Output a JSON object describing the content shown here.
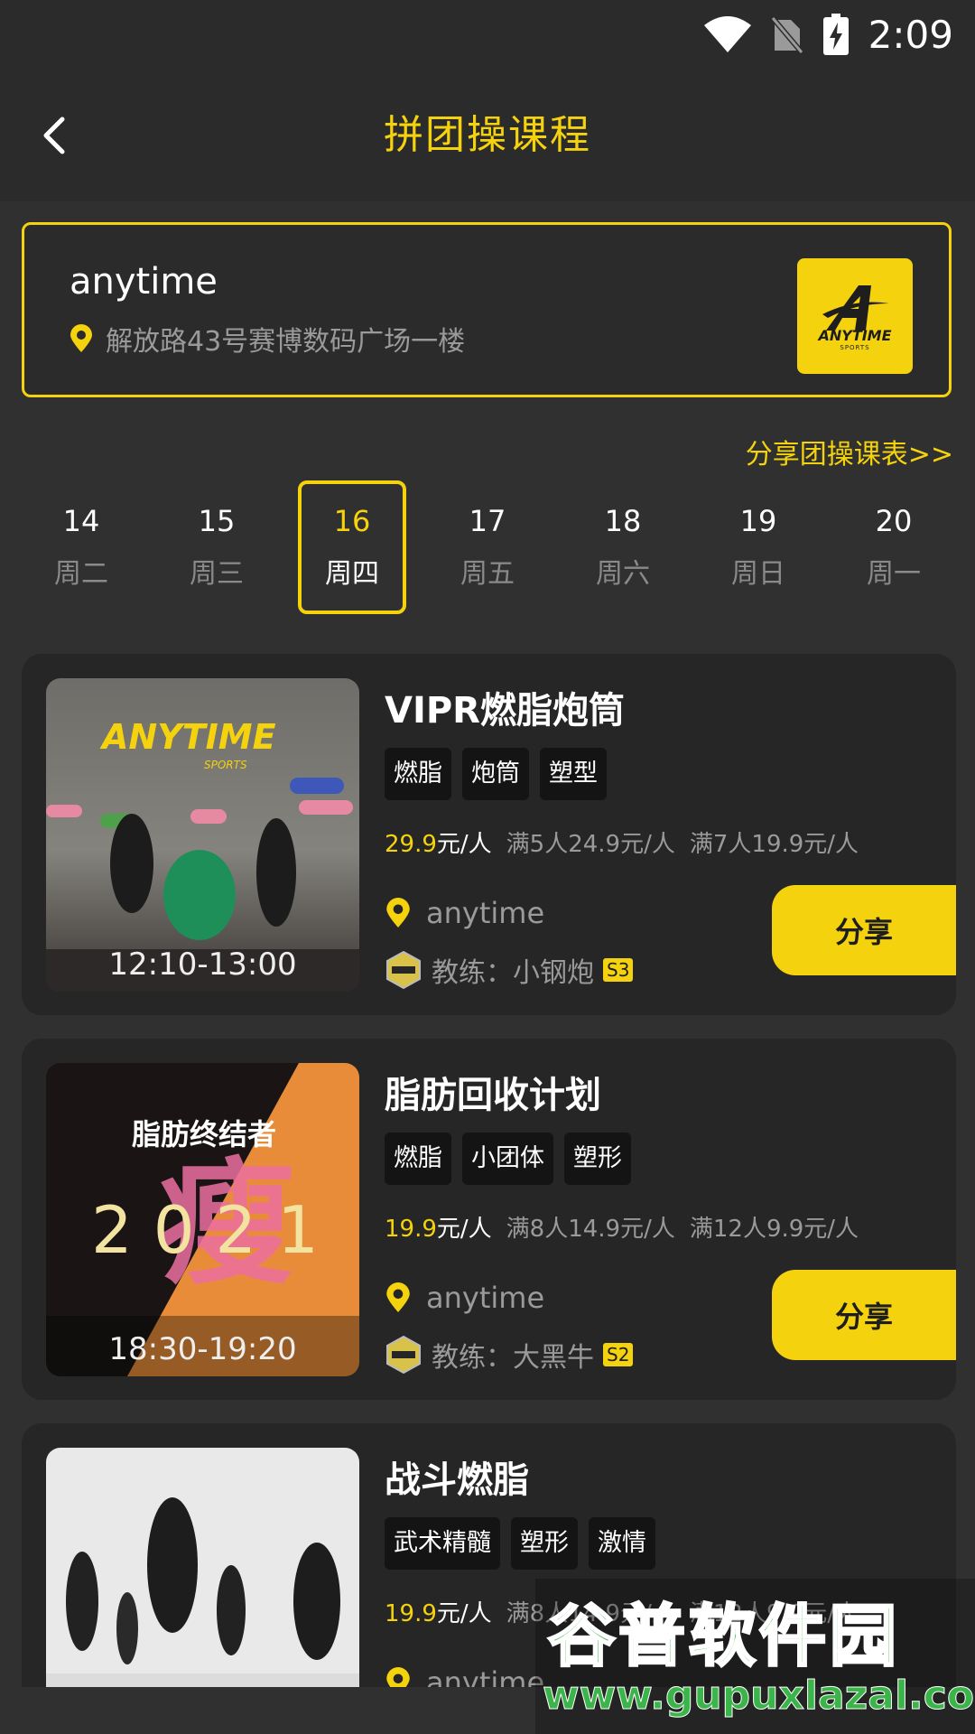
{
  "status_bar": {
    "time": "2:09"
  },
  "header": {
    "title": "拼团操课程"
  },
  "store": {
    "name": "anytime",
    "address": "解放路43号赛博数码广场一楼",
    "logo_text": "ANYTIME",
    "logo_sub": "SPORTS"
  },
  "share_schedule_label": "分享团操课表>>",
  "dates": [
    {
      "day": "14",
      "weekday": "周二",
      "active": false
    },
    {
      "day": "15",
      "weekday": "周三",
      "active": false
    },
    {
      "day": "16",
      "weekday": "周四",
      "active": true
    },
    {
      "day": "17",
      "weekday": "周五",
      "active": false
    },
    {
      "day": "18",
      "weekday": "周六",
      "active": false
    },
    {
      "day": "19",
      "weekday": "周日",
      "active": false
    },
    {
      "day": "20",
      "weekday": "周一",
      "active": false
    }
  ],
  "courses": [
    {
      "title": "VIPR燃脂炮筒",
      "time": "12:10-13:00",
      "tags": [
        "燃脂",
        "炮筒",
        "塑型"
      ],
      "price": "29.9",
      "price_unit": "元/人",
      "tiers": [
        "满5人24.9元/人",
        "满7人19.9元/人"
      ],
      "location": "anytime",
      "coach": "教练：小钢炮",
      "level": "S3",
      "share_label": "分享",
      "poster_brand": "ANYTIME",
      "poster_sub": "SPORTS"
    },
    {
      "title": "脂肪回收计划",
      "time": "18:30-19:20",
      "tags": [
        "燃脂",
        "小团体",
        "塑形"
      ],
      "price": "19.9",
      "price_unit": "元/人",
      "tiers": [
        "满8人14.9元/人",
        "满12人9.9元/人"
      ],
      "location": "anytime",
      "coach": "教练：大黑牛",
      "level": "S2",
      "share_label": "分享",
      "poster_headline": "脂肪终结者",
      "poster_year": "2 0 2 1",
      "poster_char": "瘦"
    },
    {
      "title": "战斗燃脂",
      "tags": [
        "武术精髓",
        "塑形",
        "激情"
      ],
      "price": "19.9",
      "price_unit": "元/人",
      "tiers": [
        "满8人14.9元/人",
        "满12人9.9元/人"
      ],
      "location": "anytime"
    }
  ],
  "watermark": {
    "title": "谷普软件园",
    "url": "www.gupuxlazal.com"
  },
  "colors": {
    "accent": "#f5d20e",
    "background": "#303030",
    "card": "#262626"
  }
}
